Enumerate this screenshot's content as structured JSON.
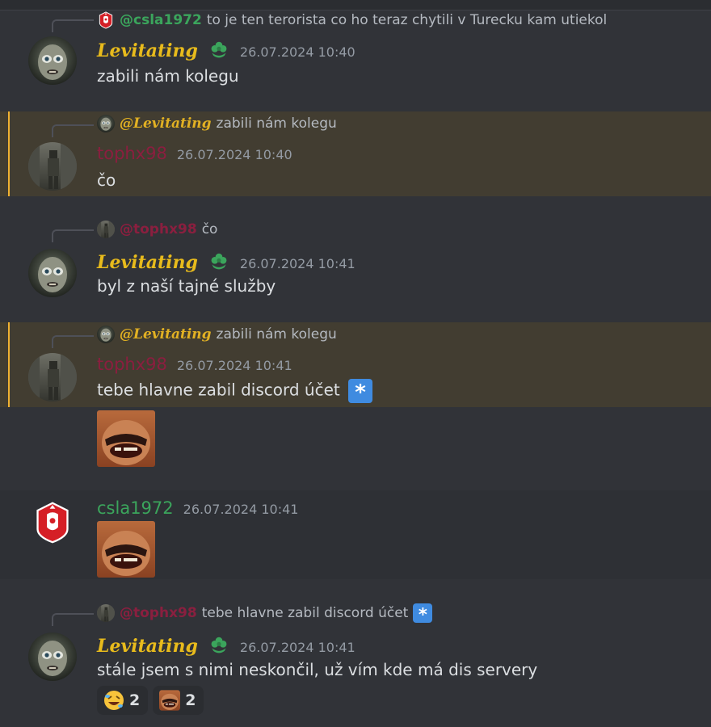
{
  "messages": [
    {
      "author": "Levitating",
      "timestamp": "26.07.2024 10:40",
      "content": "zabili nám kolegu",
      "reply": {
        "author": "@csla1972",
        "text": "to je ten terorista co ho teraz chytili v Turecku kam utiekol"
      }
    },
    {
      "author": "tophx98",
      "timestamp": "26.07.2024 10:40",
      "content": "čo",
      "reply": {
        "author": "@Levitating",
        "text": "zabili nám kolegu"
      }
    },
    {
      "author": "Levitating",
      "timestamp": "26.07.2024 10:41",
      "content": "byl z naší tajné služby",
      "reply": {
        "author": "@tophx98",
        "text": "čo"
      }
    },
    {
      "author": "tophx98",
      "timestamp": "26.07.2024 10:41",
      "content": "tebe hlavne zabil discord účet",
      "reply": {
        "author": "@Levitating",
        "text": "zabili nám kolegu"
      }
    },
    {
      "author": "csla1972",
      "timestamp": "26.07.2024 10:41"
    },
    {
      "author": "Levitating",
      "timestamp": "26.07.2024 10:41",
      "content": "stále jsem s nimi neskončil, už vím kde má dis servery",
      "reply": {
        "author": "@tophx98",
        "text": "tebe hlavne zabil discord účet"
      },
      "reactions": [
        {
          "icon": "rolling-laughing-emoji-icon",
          "count": "2"
        },
        {
          "icon": "laughing-man-sticker-icon",
          "count": "2"
        }
      ]
    }
  ],
  "colors": {
    "background": "#313338",
    "highlight": "#423d31",
    "highlight_bar": "#f0b232",
    "name_gold": "#e8bb1c",
    "name_maroon": "#8b1e3f",
    "name_green": "#3ba55c",
    "timestamp": "#949ba4"
  },
  "icons": {
    "role": "green-flower-role-icon",
    "asterisk_emoji": "asterisk-emoji-icon"
  }
}
